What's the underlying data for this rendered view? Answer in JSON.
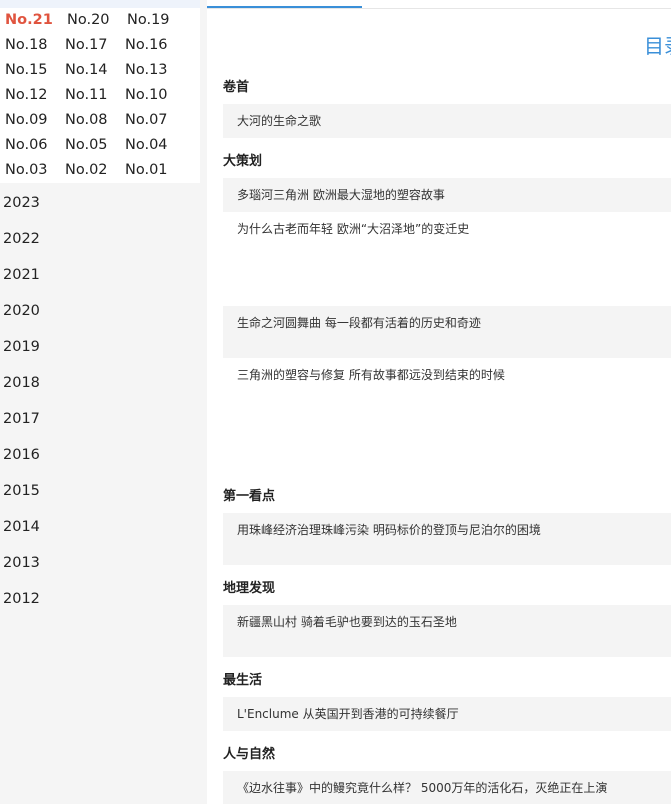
{
  "sidebar": {
    "issues": [
      [
        "No.21",
        "No.20",
        "No.19"
      ],
      [
        "No.18",
        "No.17",
        "No.16"
      ],
      [
        "No.15",
        "No.14",
        "No.13"
      ],
      [
        "No.12",
        "No.11",
        "No.10"
      ],
      [
        "No.09",
        "No.08",
        "No.07"
      ],
      [
        "No.06",
        "No.05",
        "No.04"
      ],
      [
        "No.03",
        "No.02",
        "No.01"
      ]
    ],
    "active_issue": "No.21",
    "years": [
      "2023",
      "2022",
      "2021",
      "2020",
      "2019",
      "2018",
      "2017",
      "2016",
      "2015",
      "2014",
      "2013",
      "2012"
    ]
  },
  "main": {
    "toc_title": "目录",
    "sections": [
      {
        "heading": "卷首",
        "articles": [
          "大河的生命之歌"
        ]
      },
      {
        "heading": "大策划",
        "articles": [
          "多瑙河三角洲 欧洲最大湿地的塑容故事",
          "为什么古老而年轻 欧洲“大沼泽地”的变迁史",
          "生命之河圆舞曲 每一段都有活着的历史和奇迹",
          "三角洲的塑容与修复 所有故事都远没到结束的时候"
        ]
      },
      {
        "heading": "第一看点",
        "articles": [
          "用珠峰经济治理珠峰污染 明码标价的登顶与尼泊尔的困境"
        ]
      },
      {
        "heading": "地理发现",
        "articles": [
          "新疆黑山村 骑着毛驴也要到达的玉石圣地"
        ]
      },
      {
        "heading": "最生活",
        "articles": [
          "L'Enclume 从英国开到香港的可持续餐厅"
        ]
      },
      {
        "heading": "人与自然",
        "articles": [
          "《边水往事》中的鳗究竟什么样？ 5000万年的活化石，灭绝正在上演"
        ]
      }
    ]
  },
  "colors": {
    "accent": "#3a8fd8",
    "active_issue": "#e0543f",
    "row_shade": "#f4f4f4",
    "sidebar_bg": "#f5f5f5"
  }
}
